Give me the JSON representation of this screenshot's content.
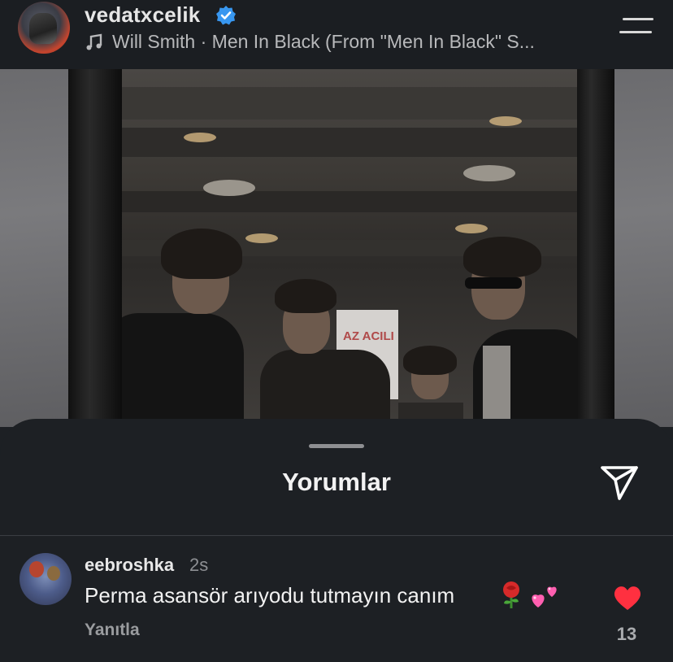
{
  "header": {
    "username": "vedatxcelik",
    "verified_icon": "verified-badge-icon",
    "music_icon": "music-note-icon",
    "song": "Will Smith · Men In Black (From \"Men In Black\" S...",
    "menu_icon": "menu-icon"
  },
  "photo": {
    "sign_text": "AZ ACILI"
  },
  "sheet": {
    "title": "Yorumlar",
    "share_icon": "send-icon"
  },
  "comment": {
    "username": "eebroshka",
    "time": "2s",
    "text": "Perma asansör arıyodu tutmayın canım",
    "emojis": [
      "rose-emoji-icon",
      "two-hearts-emoji-icon"
    ],
    "reply_label": "Yanıtla",
    "like_count": "13"
  },
  "colors": {
    "background": "#1d2024",
    "verified": "#3897f0",
    "like": "#ff3040"
  }
}
